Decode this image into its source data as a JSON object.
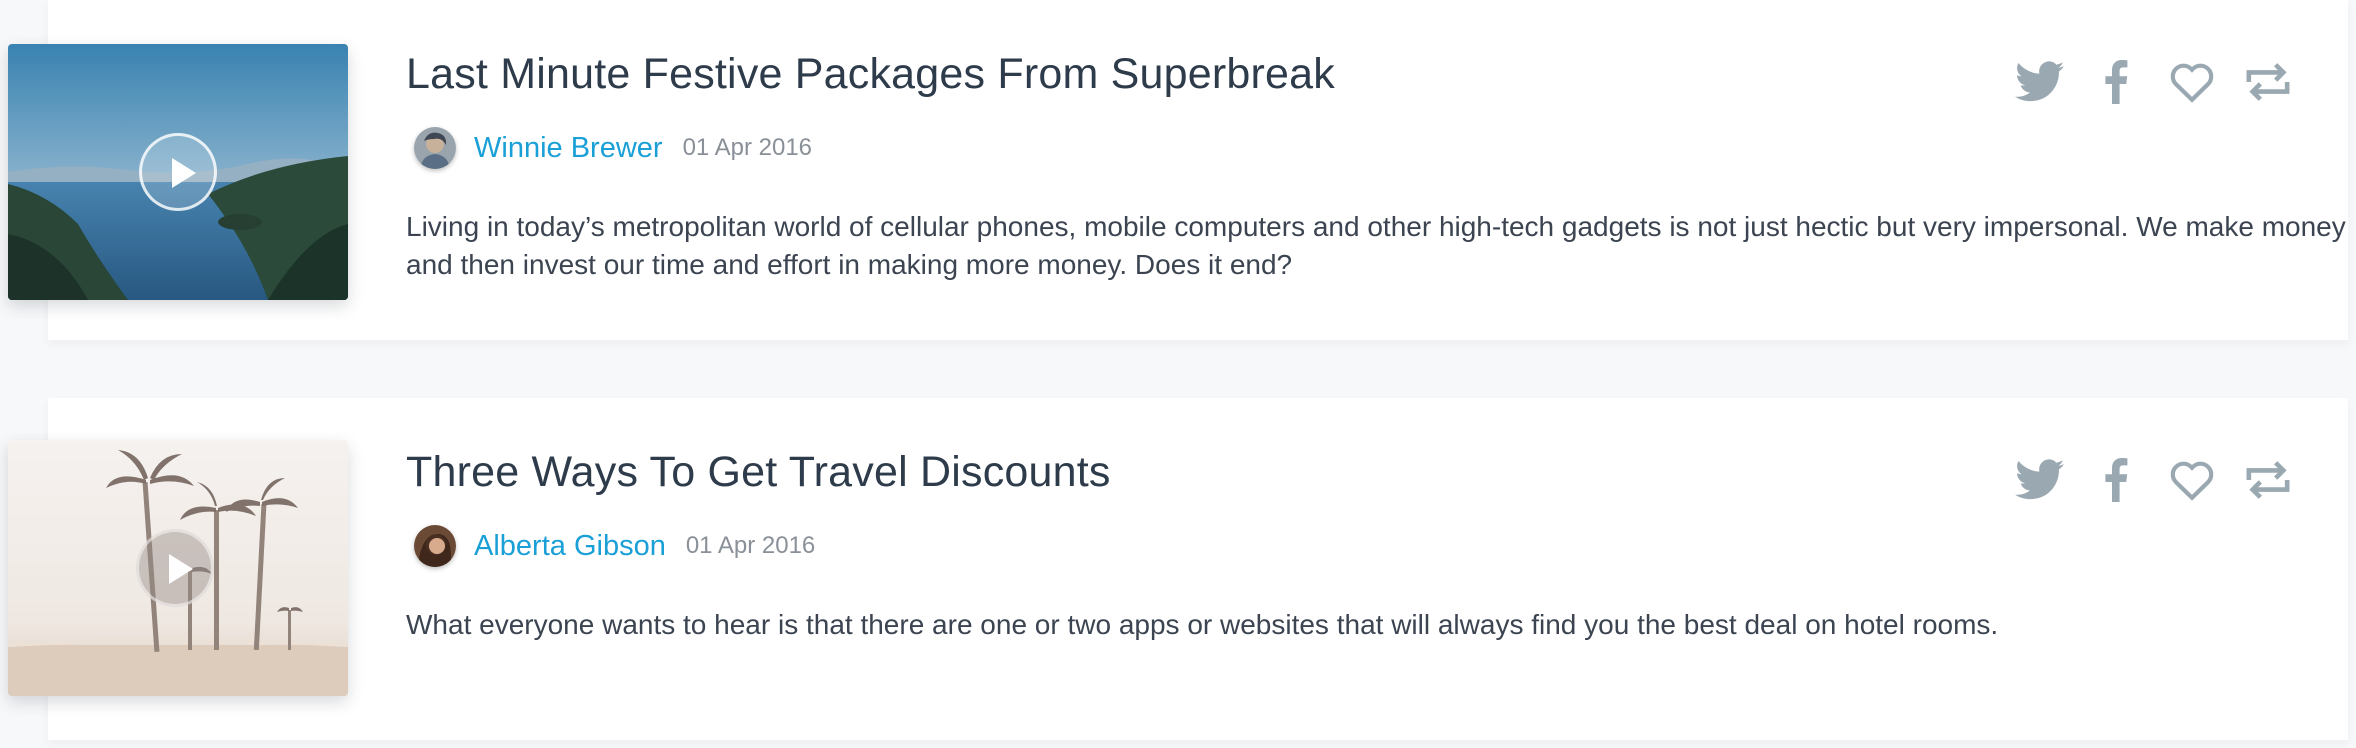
{
  "colors": {
    "title": "#2e3b4a",
    "author_link": "#1aa0d6",
    "date": "#8a9098",
    "body_text": "#3b4450",
    "action_icon": "#9aa8b1"
  },
  "posts": [
    {
      "title": "Last Minute Festive Packages From Superbreak",
      "author": "Winnie Brewer",
      "date": "01 Apr 2016",
      "excerpt": "Living in today’s metropolitan world of cellular phones, mobile computers and other high-tech gadgets is not just hectic but very impersonal. We make money and then invest our time and effort in making more money. Does it end?",
      "thumbnail_icon": "play-icon",
      "actions": [
        "twitter-icon",
        "facebook-icon",
        "heart-icon",
        "repost-icon"
      ]
    },
    {
      "title": "Three Ways To Get Travel Discounts",
      "author": "Alberta Gibson",
      "date": "01 Apr 2016",
      "excerpt": "What everyone wants to hear is that there are one or two apps or websites that will always find you the best deal on hotel rooms.",
      "thumbnail_icon": "play-icon",
      "actions": [
        "twitter-icon",
        "facebook-icon",
        "heart-icon",
        "repost-icon"
      ]
    }
  ]
}
